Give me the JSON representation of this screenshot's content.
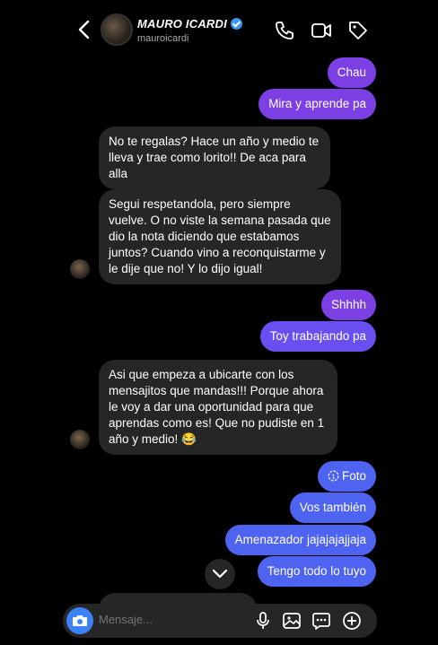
{
  "header": {
    "name": "MAURO ICARDI",
    "handle": "mauroicardi",
    "icons": [
      "back-icon",
      "phone-icon",
      "video-icon",
      "tag-icon"
    ]
  },
  "messages": [
    {
      "side": "out",
      "color": "#7b3fe4",
      "text": "Chau"
    },
    {
      "side": "out",
      "color": "#7b3fe4",
      "text": "Mira y aprende pa"
    },
    {
      "side": "in",
      "text": "No te regalas? Hace un año y medio te lleva y trae como lorito!! De aca para alla"
    },
    {
      "side": "in",
      "text": "Segui respetandola, pero siempre vuelve. O no viste la semana pasada que dio la nota diciendo que estabamos juntos? Cuando vino a reconquistarme y le dije que no! Y lo dijo igual!"
    },
    {
      "side": "out",
      "color": "#7b3fe4",
      "text": "Shhhh"
    },
    {
      "side": "out",
      "color": "#6a4ff0",
      "text": "Toy trabajando pa"
    },
    {
      "side": "in",
      "text": "Asi que empeza a ubicarte con los mensajitos que mandas!!! Porque ahora le voy a dar una oportunidad para que aprendas como es! Que no pudiste en 1 año y medio! 😂"
    },
    {
      "side": "out",
      "color": "#4e63ef",
      "text": "Foto",
      "icon": "view-once-icon"
    },
    {
      "side": "out",
      "color": "#4e63ef",
      "text": "Vos también"
    },
    {
      "side": "out",
      "color": "#4e63ef",
      "text": "Amenazador jajajajajjaja"
    },
    {
      "side": "out",
      "color": "#4e63ef",
      "text": "Tengo todo lo tuyo"
    }
  ],
  "composer": {
    "placeholder": "Mensaje...",
    "icons": [
      "camera-icon",
      "microphone-icon",
      "gallery-icon",
      "sticker-icon",
      "plus-icon"
    ],
    "camera_color": "#3b82f6"
  }
}
